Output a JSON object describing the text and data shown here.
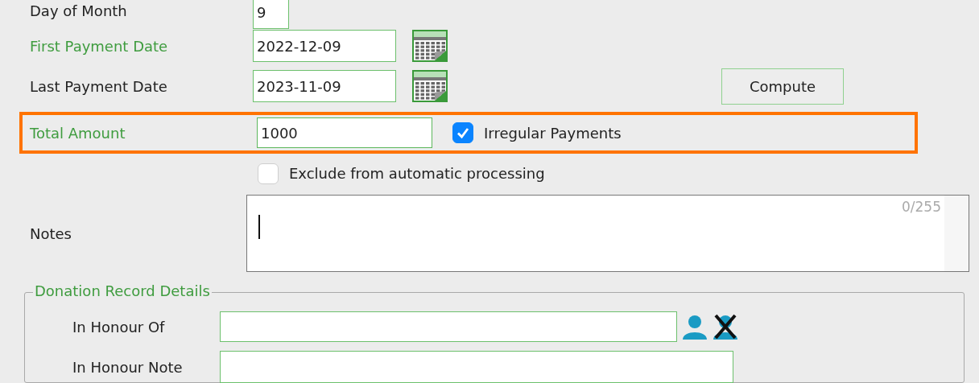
{
  "fields": [
    {
      "kind": "number",
      "label": "Day of Month",
      "required": false,
      "value": "9"
    },
    {
      "kind": "date",
      "label": "First Payment Date",
      "required": true,
      "value": "2022-12-09"
    },
    {
      "kind": "date",
      "label": "Last Payment Date",
      "required": false,
      "value": "2023-11-09",
      "action": "Compute"
    }
  ],
  "total": {
    "label": "Total Amount",
    "required": true,
    "value": "1000",
    "highlighted": true,
    "option": {
      "label": "Irregular Payments",
      "checked": true
    }
  },
  "exclude": {
    "label": "Exclude from automatic processing",
    "checked": false
  },
  "notes": {
    "label": "Notes",
    "counter": "0/255"
  },
  "donation_details": {
    "title": "Donation Record Details",
    "fields": [
      {
        "kind": "person",
        "label": "In Honour Of"
      },
      {
        "kind": "text",
        "label": "In Honour Note"
      }
    ]
  }
}
